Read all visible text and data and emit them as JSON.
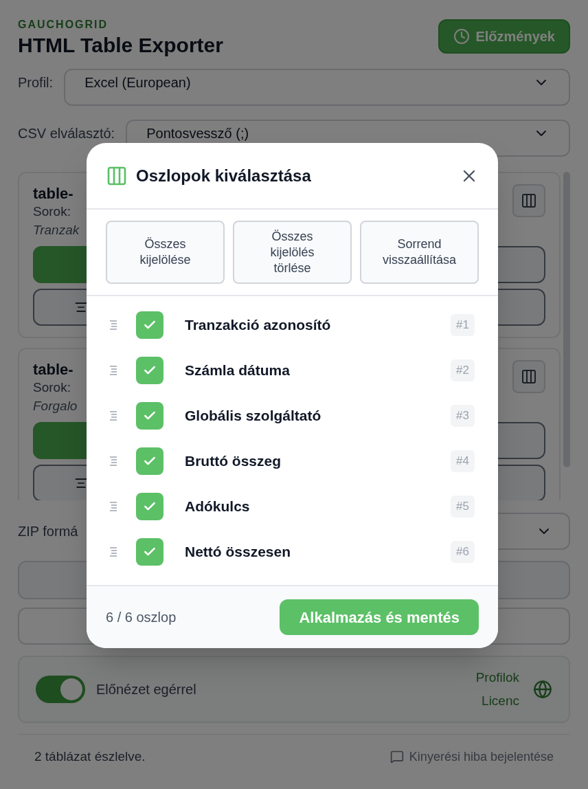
{
  "app": {
    "brand": "GAUCHOGRID",
    "title": "HTML Table Exporter",
    "history_button": "Előzmények"
  },
  "settings": [
    {
      "label": "Profil:",
      "value": "Excel (European)"
    },
    {
      "label": "CSV elválasztó:",
      "value": "Pontosvessző (;)"
    }
  ],
  "tables": [
    {
      "name": "table-",
      "rows": "Sorok:",
      "description": "Tranzak"
    },
    {
      "name": "table-",
      "rows": "Sorok:",
      "description": "Forgalo"
    }
  ],
  "zip": {
    "label": "ZIP formá"
  },
  "footer": {
    "toggle_label": "Előnézet egérrel",
    "on": true,
    "links": [
      "Profilok",
      "Licenc"
    ],
    "status": "2 táblázat észlelve.",
    "report_link": "Kinyerési hiba bejelentése"
  },
  "modal": {
    "title": "Oszlopok kiválasztása",
    "actions": [
      "Összes kijelölése",
      "Összes kijelölés törlése",
      "Sorrend visszaállítása"
    ],
    "columns": [
      {
        "name": "Tranzakció azonosító",
        "checked": true,
        "order": "#1"
      },
      {
        "name": "Számla dátuma",
        "checked": true,
        "order": "#2"
      },
      {
        "name": "Globális szolgáltató",
        "checked": true,
        "order": "#3"
      },
      {
        "name": "Bruttó összeg",
        "checked": true,
        "order": "#4"
      },
      {
        "name": "Adókulcs",
        "checked": true,
        "order": "#5"
      },
      {
        "name": "Nettó összesen",
        "checked": true,
        "order": "#6"
      }
    ],
    "count": "6 / 6 oszlop",
    "apply_button": "Alkalmazás és mentés"
  }
}
